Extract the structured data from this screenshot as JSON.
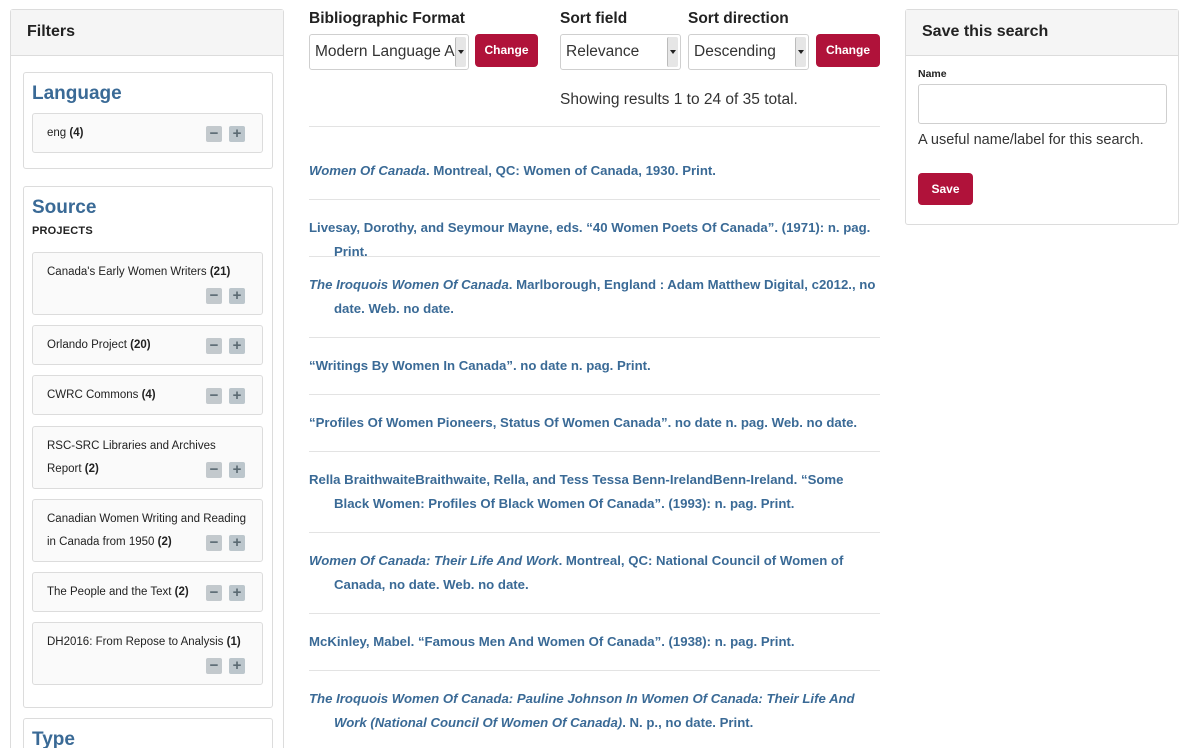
{
  "filters": {
    "title": "Filters",
    "language": {
      "title": "Language",
      "items": [
        {
          "label": "eng",
          "count": "(4)"
        }
      ]
    },
    "source": {
      "title": "Source",
      "subtitle": "PROJECTS",
      "items": [
        {
          "label": "Canada's Early Women Writers",
          "count": "(21)"
        },
        {
          "label": "Orlando Project",
          "count": "(20)"
        },
        {
          "label": "CWRC Commons",
          "count": "(4)"
        },
        {
          "label": "RSC-SRC Libraries and Archives Report",
          "count": "(2)"
        },
        {
          "label": "Canadian Women Writing and Reading in Canada from 1950",
          "count": "(2)"
        },
        {
          "label": "The People and the Text",
          "count": "(2)"
        },
        {
          "label": "DH2016: From Repose to Analysis",
          "count": "(1)"
        }
      ]
    },
    "type": {
      "title": "Type"
    }
  },
  "controls": {
    "format_label": "Bibliographic Format",
    "format_value": "Modern Language A",
    "format_change": "Change",
    "sort_field_label": "Sort field",
    "sort_field_value": "Relevance",
    "sort_direction_label": "Sort direction",
    "sort_direction_value": "Descending",
    "sort_change": "Change"
  },
  "results_summary": "Showing results 1 to 24 of 35 total.",
  "results": [
    {
      "lead_italic": "Women Of Canada",
      "rest": ". Montreal, QC: Women of Canada, 1930. Print."
    },
    {
      "lead_italic": "",
      "rest": "Livesay, Dorothy, and Seymour Mayne, eds. “40 Women Poets Of Canada”. (1971): n. pag. Print."
    },
    {
      "lead_italic": "The Iroquois Women Of Canada",
      "rest": ". Marlborough, England : Adam Matthew Digital, c2012., no date. Web. no date."
    },
    {
      "lead_italic": "",
      "rest": "“Writings By Women In Canada”. no date n. pag. Print."
    },
    {
      "lead_italic": "",
      "rest": "“Profiles Of Women Pioneers, Status Of Women Canada”. no date n. pag. Web. no date."
    },
    {
      "lead_italic": "",
      "rest": "Rella BraithwaiteBraithwaite, Rella, and Tess Tessa Benn-IrelandBenn-Ireland. “Some Black Women: Profiles Of Black Women Of Canada”. (1993): n. pag. Print."
    },
    {
      "lead_italic": "Women Of Canada: Their Life And Work",
      "rest": ". Montreal, QC: National Council of Women of Canada, no date. Web. no date."
    },
    {
      "lead_italic": "",
      "rest": "McKinley, Mabel. “Famous Men And Women Of Canada”. (1938): n. pag. Print."
    },
    {
      "lead_italic": "The Iroquois Women Of Canada: Pauline Johnson In Women Of Canada: Their Life And Work (National Council Of Women Of Canada)",
      "rest": ". N. p., no date. Print."
    }
  ],
  "save_search": {
    "title": "Save this search",
    "name_label": "Name",
    "name_value": "",
    "help": "A useful name/label for this search.",
    "save_label": "Save"
  },
  "colors": {
    "accent": "#b0123a",
    "link": "#3a6a96"
  },
  "icons": {
    "add": "plus-icon",
    "remove": "minus-icon"
  }
}
